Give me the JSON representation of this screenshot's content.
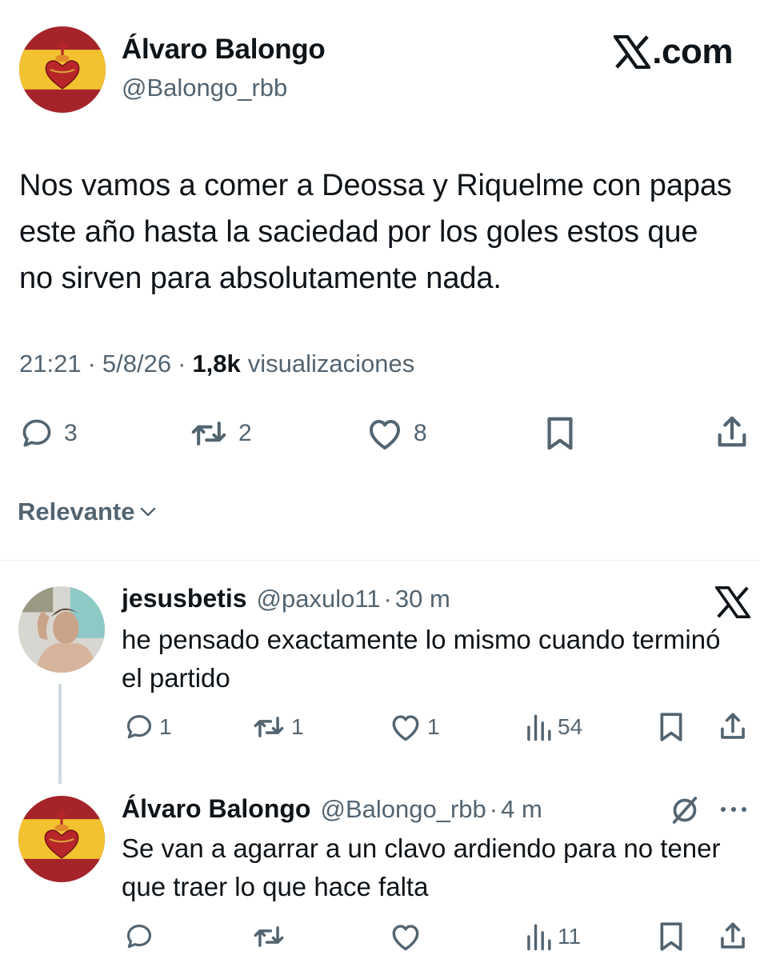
{
  "post": {
    "author_name": "Álvaro Balongo",
    "author_handle": "@Balongo_rbb",
    "brand": ".com",
    "text": "Nos vamos a comer a Deossa y Riquelme con papas este año hasta la saciedad por los goles estos que no sirven para absolutamente nada.",
    "time": "21:21",
    "date": "5/8/26",
    "separator": "·",
    "views_count": "1,8k",
    "views_label": "visualizaciones",
    "stats": {
      "replies": "3",
      "reposts": "2",
      "likes": "8"
    }
  },
  "sort": {
    "label": "Relevante"
  },
  "replies": [
    {
      "author_name": "jesusbetis",
      "author_handle": "@paxulo11",
      "time_ago": "30 m",
      "text": "he pensado exactamente lo mismo cuando terminó el partido",
      "stats": {
        "replies": "1",
        "reposts": "1",
        "likes": "1",
        "views": "54"
      }
    },
    {
      "author_name": "Álvaro Balongo",
      "author_handle": "@Balongo_rbb",
      "time_ago": "4 m",
      "text": "Se van a agarrar a un clavo ardiendo para no tener que traer lo que hace falta",
      "stats": {
        "views": "11"
      }
    }
  ],
  "icons": {
    "reply": "reply-icon",
    "repost": "repost-icon",
    "like": "heart-icon",
    "bookmark": "bookmark-icon",
    "share": "share-icon",
    "views": "views-icon",
    "more": "more-icon",
    "x_logo": "x-logo-icon",
    "mute": "mute-icon"
  },
  "colors": {
    "text": "#0f1419",
    "secondary": "#536471",
    "flag_red": "#a4242a",
    "flag_yellow": "#f2c230"
  }
}
